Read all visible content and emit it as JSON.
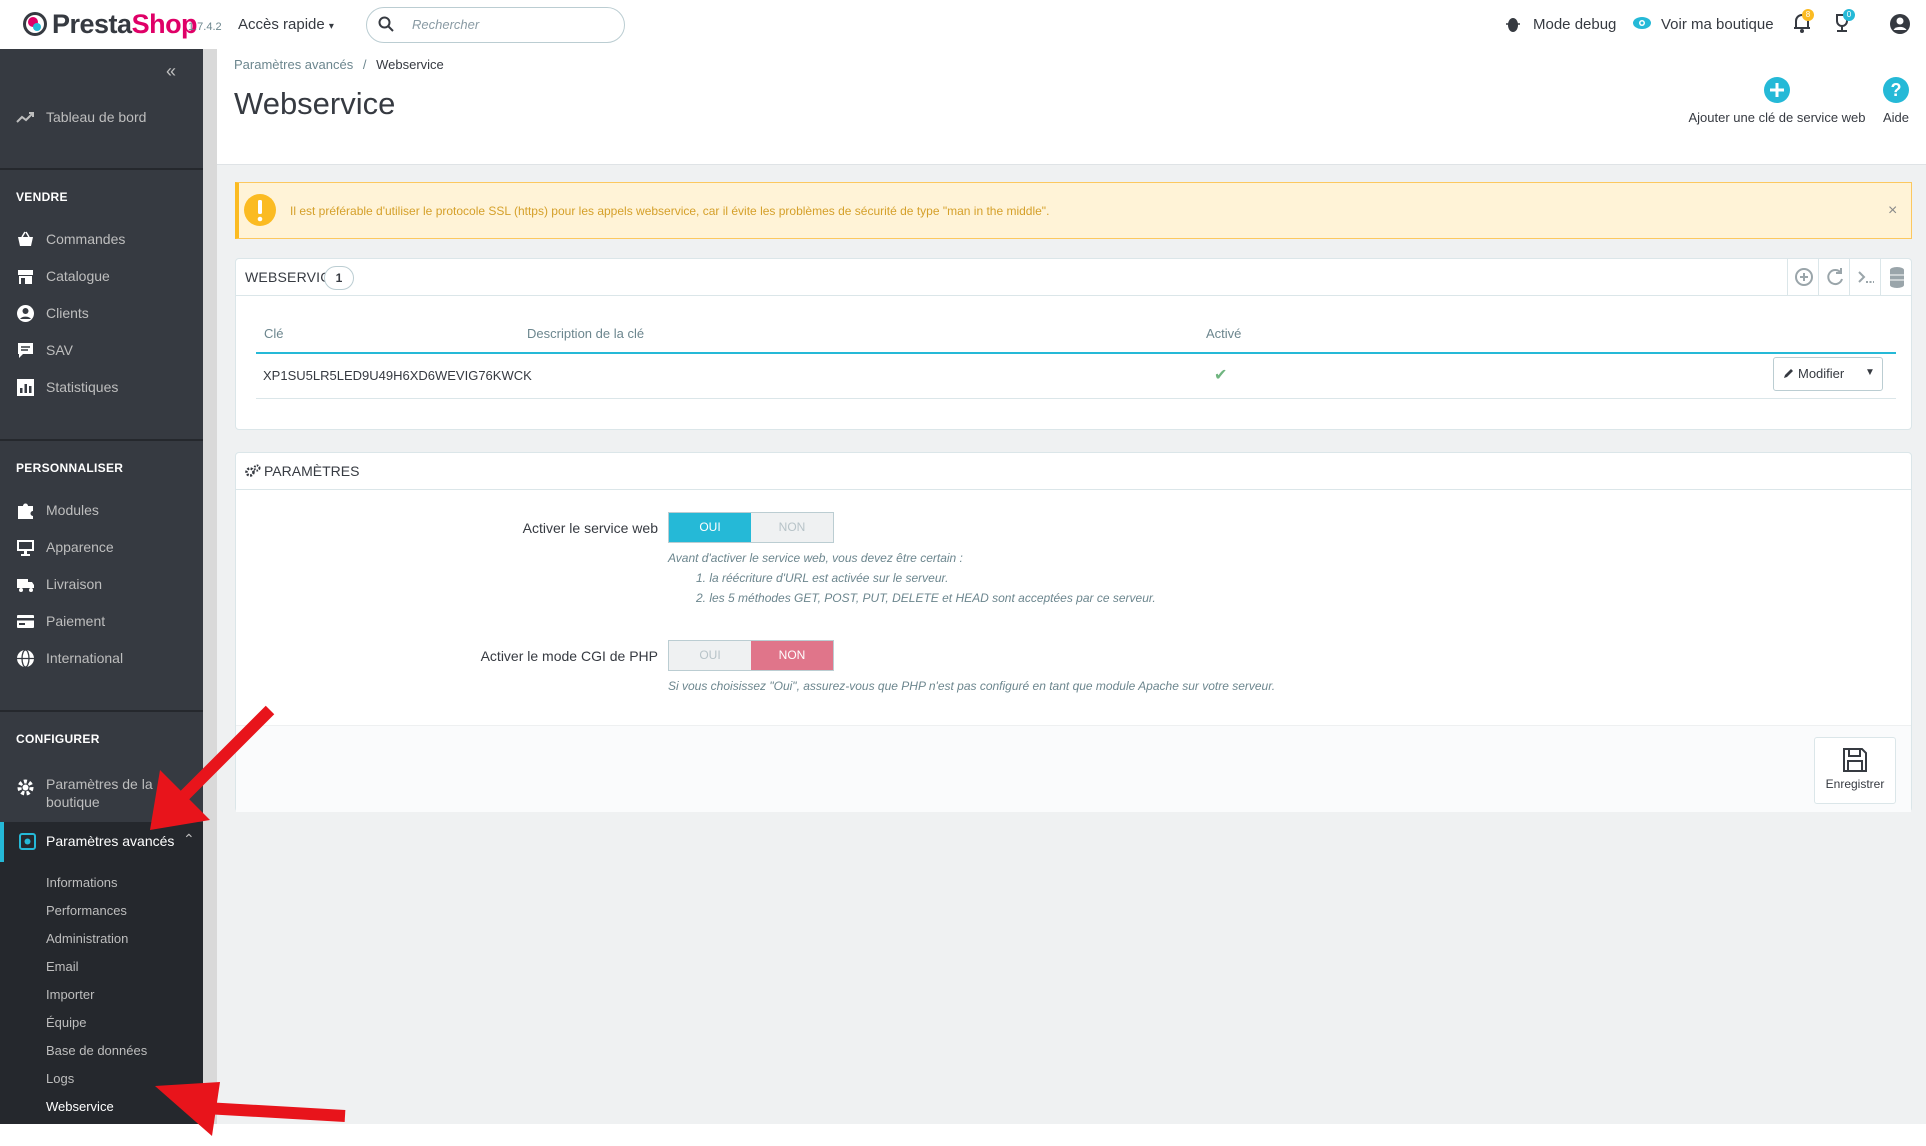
{
  "header": {
    "logo_prefix": "Presta",
    "logo_suffix": "Shop",
    "version": "1.7.4.2",
    "quick_access": "Accès rapide",
    "search_placeholder": "Rechercher",
    "debug_mode": "Mode debug",
    "view_shop": "Voir ma boutique",
    "notifications_badge": "8",
    "customers_badge": "0"
  },
  "sidebar": {
    "collapse_glyph": "«",
    "dashboard": "Tableau de bord",
    "sections": {
      "sell": "VENDRE",
      "customize": "PERSONNALISER",
      "configure": "CONFIGURER"
    },
    "sell_items": [
      "Commandes",
      "Catalogue",
      "Clients",
      "SAV",
      "Statistiques"
    ],
    "customize_items": [
      "Modules",
      "Apparence",
      "Livraison",
      "Paiement",
      "International"
    ],
    "shop_params": "Paramètres de la boutique",
    "advanced_params": "Paramètres avancés",
    "advanced_sub": [
      "Informations",
      "Performances",
      "Administration",
      "Email",
      "Importer",
      "Équipe",
      "Base de données",
      "Logs",
      "Webservice"
    ]
  },
  "breadcrumb": {
    "parent": "Paramètres avancés",
    "separator": "/",
    "current": "Webservice"
  },
  "page_title": "Webservice",
  "toolbar": {
    "add_key": "Ajouter une clé de service web",
    "help": "Aide"
  },
  "alert": {
    "text": "Il est préférable d'utiliser le protocole SSL (https) pour les appels webservice, car il évite les problèmes de sécurité de type \"man in the middle\".",
    "close": "×"
  },
  "webservice_panel": {
    "title": "WEBSERVICE",
    "count": "1",
    "columns": [
      "Clé",
      "Description de la clé",
      "Activé"
    ],
    "rows": [
      {
        "key": "XP1SU5LR5LED9U49H6XD6WEVIG76KWCK",
        "description": "",
        "active": "✔",
        "action": "Modifier"
      }
    ]
  },
  "settings_panel": {
    "title": "PARAMÈTRES",
    "webservice_label": "Activer le service web",
    "yes": "OUI",
    "no": "NON",
    "help_line1": "Avant d'activer le service web, vous devez être certain :",
    "help_line2": "1. la réécriture d'URL est activée sur le serveur.",
    "help_line3": "2. les 5 méthodes GET, POST, PUT, DELETE et HEAD sont acceptées par ce serveur.",
    "cgi_label": "Activer le mode CGI de PHP",
    "cgi_help": "Si vous choisissez \"Oui\", assurez-vous que PHP n'est pas configuré en tant que module Apache sur votre serveur.",
    "save": "Enregistrer"
  },
  "colors": {
    "sidebar_bg": "#363a41",
    "brand_pink": "#df0067",
    "accent_blue": "#25b9d7",
    "danger": "#f54c3e",
    "arrow_red": "#e8141b"
  }
}
